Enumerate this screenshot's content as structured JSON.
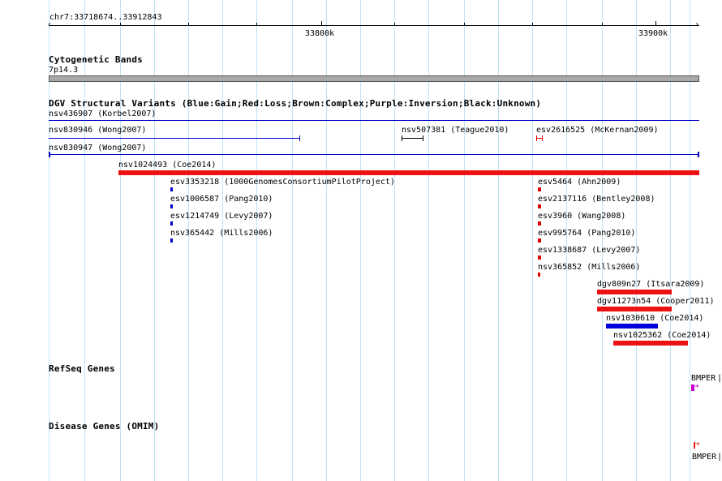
{
  "ruler": {
    "range_label": "chr7:33718674..33912843",
    "major_labels": [
      "33800k",
      "33900k"
    ]
  },
  "cytobands": {
    "title": "Cytogenetic Bands",
    "band_label": "7p14.3"
  },
  "dgv": {
    "title": "DGV Structural Variants (Blue:Gain;Red:Loss;Brown:Complex;Purple:Inversion;Black:Unknown)",
    "features": [
      {
        "label": "nsv436907 (Korbel2007)",
        "color": "#0000cc"
      },
      {
        "label": "nsv830946 (Wong2007)",
        "color": "#0000cc"
      },
      {
        "label": "nsv507381 (Teague2010)",
        "color": "#000000"
      },
      {
        "label": "esv2616525 (McKernan2009)",
        "color": "#dd0000"
      },
      {
        "label": "nsv830947 (Wong2007)",
        "color": "#0000cc"
      },
      {
        "label": "nsv1024493 (Coe2014)",
        "color": "#ee1111"
      },
      {
        "label": "esv3353218 (1000GenomesConsortiumPilotProject)",
        "color": "#0000cc"
      },
      {
        "label": "esv1006587 (Pang2010)",
        "color": "#0000cc"
      },
      {
        "label": "esv1214749 (Levy2007)",
        "color": "#0000cc"
      },
      {
        "label": "nsv365442 (Mills2006)",
        "color": "#0000cc"
      },
      {
        "label": "esv5464 (Ahn2009)",
        "color": "#dd0000"
      },
      {
        "label": "esv2137116 (Bentley2008)",
        "color": "#dd0000"
      },
      {
        "label": "esv3960 (Wang2008)",
        "color": "#dd0000"
      },
      {
        "label": "esv995764 (Pang2010)",
        "color": "#dd0000"
      },
      {
        "label": "esv1338687 (Levy2007)",
        "color": "#dd0000"
      },
      {
        "label": "nsv365852 (Mills2006)",
        "color": "#dd0000"
      },
      {
        "label": "dgv809n27 (Itsara2009)",
        "color": "#ee1111"
      },
      {
        "label": "dgv11273n54 (Cooper2011)",
        "color": "#ee1111"
      },
      {
        "label": "nsv1030610 (Coe2014)",
        "color": "#0000dd"
      },
      {
        "label": "nsv1025362 (Coe2014)",
        "color": "#ee1111"
      }
    ]
  },
  "refseq": {
    "title": "RefSeq Genes",
    "gene_label": "BMPER",
    "color": "#cc00cc"
  },
  "omim": {
    "title": "Disease Genes (OMIM)",
    "gene_label": "BMPER",
    "color": "#ee2222"
  }
}
